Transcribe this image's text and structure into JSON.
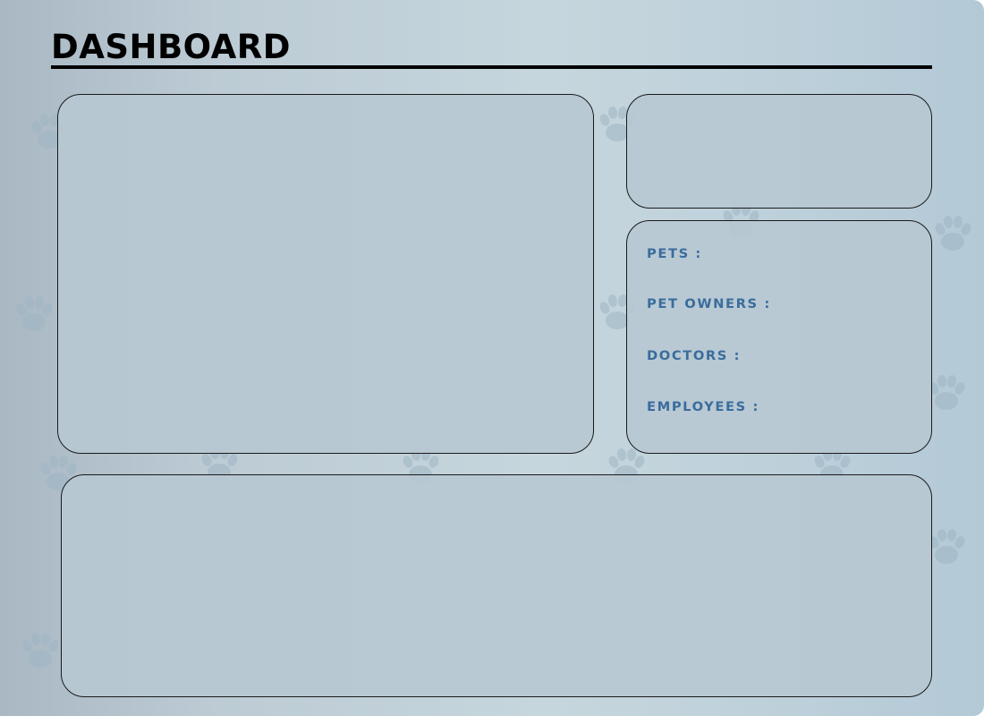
{
  "header": {
    "title": "DASHBOARD"
  },
  "stats": {
    "items": [
      {
        "label": "PETS :"
      },
      {
        "label": "PET OWNERS :"
      },
      {
        "label": "DOCTORS :"
      },
      {
        "label": "EMPLOYEES :"
      }
    ]
  },
  "theme": {
    "label_color": "#3a6c9c",
    "panel_border": "#1a1a1a",
    "background_pattern": "paw-print-icon"
  }
}
